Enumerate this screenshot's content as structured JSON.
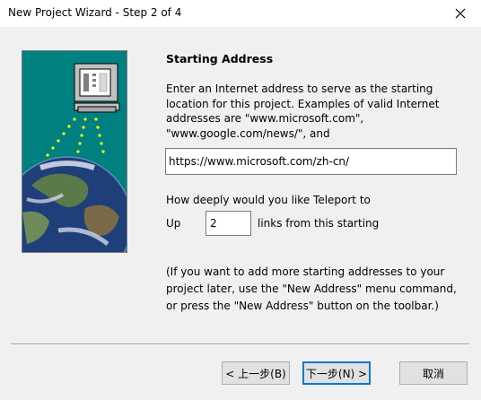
{
  "window": {
    "title": "New Project Wizard - Step 2 of 4",
    "close_icon": "close-icon"
  },
  "main": {
    "heading": "Starting Address",
    "description_lines": [
      "Enter an Internet address to serve as the starting",
      "location for this project.  Examples of valid Internet",
      "addresses are \"www.microsoft.com\",",
      "\"www.google.com/news/\", and"
    ],
    "url_value": "https://www.microsoft.com/zh-cn/",
    "depth_question": "How deeply would you like Teleport to",
    "up_label": "Up",
    "depth_value": "2",
    "links_label": "links from this starting",
    "note_lines": [
      "(If you want to add more starting addresses to your",
      "project later, use the \"New Address\" menu command,",
      "or press the \"New Address\" button on the toolbar.)"
    ]
  },
  "buttons": {
    "back_label": "< 上一步(B)",
    "next_label": "下一步(N) >",
    "cancel_label": "取消"
  },
  "graphic": {
    "description_icon": "computer-over-globe-icon",
    "background_color": "#008080"
  }
}
